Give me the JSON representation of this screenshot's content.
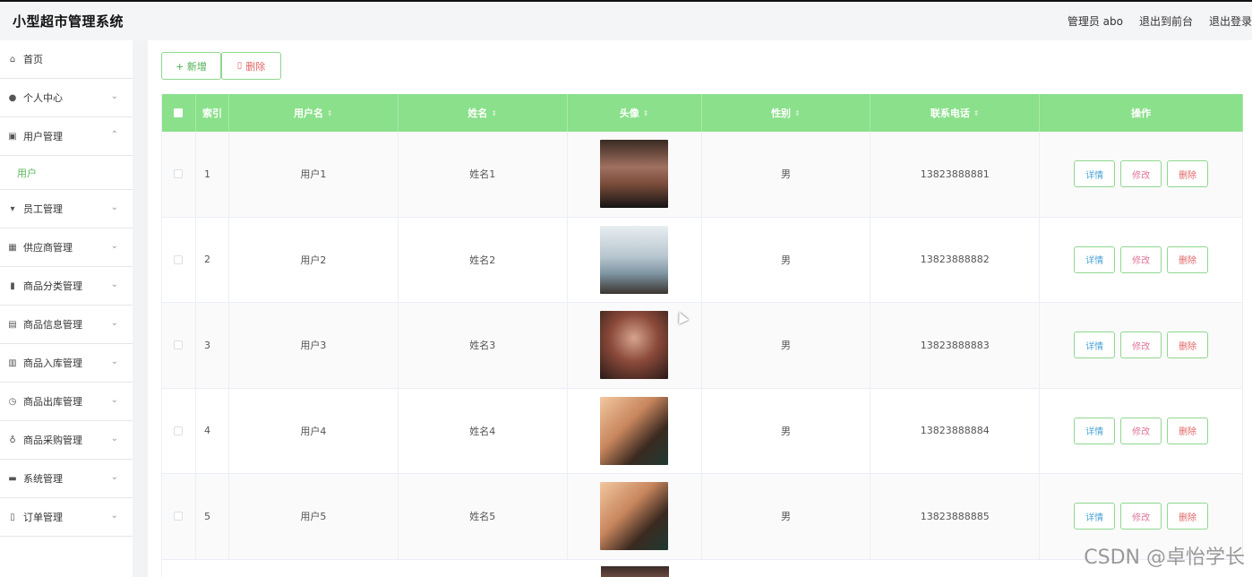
{
  "app": {
    "title": "小型超市管理系统",
    "admin": "管理员 abo",
    "back_front": "退出到前台",
    "logout": "退出登录"
  },
  "sidebar": {
    "items": [
      {
        "label": "首页",
        "icon": "home-icon"
      },
      {
        "label": "个人中心",
        "icon": "user-icon"
      },
      {
        "label": "用户管理",
        "icon": "chart-icon",
        "expanded": true,
        "children": [
          "用户"
        ]
      },
      {
        "label": "员工管理",
        "icon": "stamp-icon"
      },
      {
        "label": "供应商管理",
        "icon": "grid-icon"
      },
      {
        "label": "商品分类管理",
        "icon": "bar-icon"
      },
      {
        "label": "商品信息管理",
        "icon": "clipboard-icon"
      },
      {
        "label": "商品入库管理",
        "icon": "list-icon"
      },
      {
        "label": "商品出库管理",
        "icon": "clock-icon"
      },
      {
        "label": "商品采购管理",
        "icon": "mic-icon"
      },
      {
        "label": "系统管理",
        "icon": "monitor-icon"
      },
      {
        "label": "订单管理",
        "icon": "phone-icon"
      }
    ]
  },
  "toolbar": {
    "add": "+ 新增",
    "delete": "删除"
  },
  "table": {
    "headers": [
      "索引",
      "用户名",
      "姓名",
      "头像",
      "性别",
      "联系电话",
      "操作"
    ],
    "rows": [
      {
        "index": "1",
        "username": "用户1",
        "name": "姓名1",
        "gender": "男",
        "phone": "13823888881"
      },
      {
        "index": "2",
        "username": "用户2",
        "name": "姓名2",
        "gender": "男",
        "phone": "13823888882"
      },
      {
        "index": "3",
        "username": "用户3",
        "name": "姓名3",
        "gender": "男",
        "phone": "13823888883"
      },
      {
        "index": "4",
        "username": "用户4",
        "name": "姓名4",
        "gender": "男",
        "phone": "13823888884"
      },
      {
        "index": "5",
        "username": "用户5",
        "name": "姓名5",
        "gender": "男",
        "phone": "13823888885"
      }
    ],
    "actions": {
      "detail": "详情",
      "edit": "修改",
      "remove": "删除"
    }
  },
  "watermark": "CSDN @卓怡学长",
  "colors": {
    "accent": "#8be08b",
    "link": "#5cb85c",
    "danger": "#e06666"
  }
}
